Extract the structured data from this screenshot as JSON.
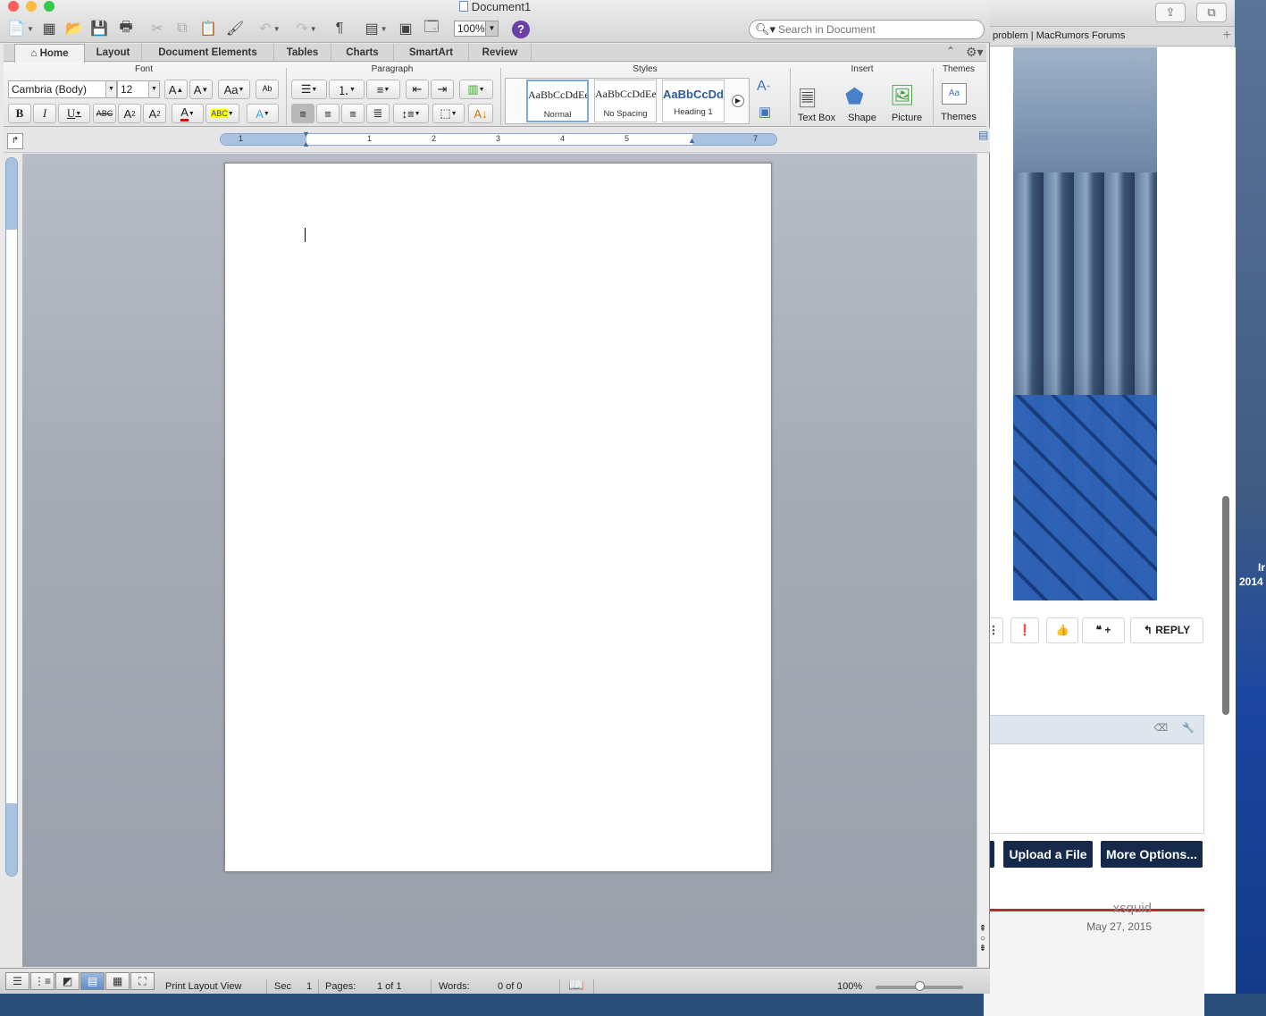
{
  "word": {
    "title": "Document1",
    "zoom": "100%",
    "help_label": "?",
    "search_placeholder": "Search in Document",
    "tabs": [
      "Home",
      "Layout",
      "Document Elements",
      "Tables",
      "Charts",
      "SmartArt",
      "Review"
    ],
    "active_tab": "Home",
    "groups": {
      "font": "Font",
      "paragraph": "Paragraph",
      "styles": "Styles",
      "insert": "Insert",
      "themes": "Themes"
    },
    "font_name": "Cambria (Body)",
    "font_size": "12",
    "styles": [
      {
        "sample": "AaBbCcDdEe",
        "name": "Normal"
      },
      {
        "sample": "AaBbCcDdEe",
        "name": "No Spacing"
      },
      {
        "sample": "AaBbCcDd",
        "name": "Heading 1"
      }
    ],
    "insert_buttons": [
      "Text Box",
      "Shape",
      "Picture"
    ],
    "themes_button": "Themes",
    "ruler_numbers": [
      "1",
      "1",
      "2",
      "3",
      "4",
      "5",
      "7"
    ],
    "status": {
      "view": "Print Layout View",
      "sec_label": "Sec",
      "sec_value": "1",
      "pages_label": "Pages:",
      "pages_value": "1 of 1",
      "words_label": "Words:",
      "words_value": "0 of 0",
      "zoom": "100%"
    }
  },
  "browser": {
    "tab_title": "problem | MacRumors Forums",
    "reply_label": "REPLY",
    "upload_label": "Upload a File",
    "more_options_label": "More Options...",
    "username": "xsquid",
    "post_date": "May 27, 2015",
    "side_text_1": "Ir",
    "side_text_2": "2014"
  },
  "colors": {
    "close": "#fc605c",
    "minimize": "#fdbc40",
    "zoom": "#34c84a",
    "forum_button": "#152a4a"
  }
}
